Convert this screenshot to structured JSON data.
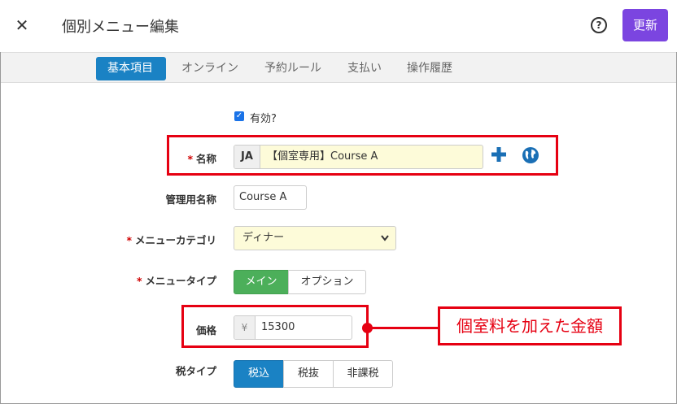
{
  "header": {
    "close_icon": "close-icon",
    "title": "個別メニュー編集",
    "help_icon": "help-icon",
    "update_label": "更新"
  },
  "tabs": [
    {
      "label": "基本項目",
      "active": true
    },
    {
      "label": "オンライン",
      "active": false
    },
    {
      "label": "予約ルール",
      "active": false
    },
    {
      "label": "支払い",
      "active": false
    },
    {
      "label": "操作履歴",
      "active": false
    }
  ],
  "form": {
    "enabled": {
      "label": "有効?",
      "checked": true
    },
    "required_mark": "*",
    "name": {
      "label": "名称",
      "lang": "JA",
      "value": "【個室専用】Course A"
    },
    "admin_name": {
      "label": "管理用名称",
      "value": "Course A"
    },
    "category": {
      "label": "メニューカテゴリ",
      "selected": "ディナー"
    },
    "menu_type": {
      "label": "メニュータイプ",
      "options": [
        "メイン",
        "オプション"
      ],
      "selected": "メイン"
    },
    "price": {
      "label": "価格",
      "currency": "¥",
      "value": "15300"
    },
    "tax_type": {
      "label": "税タイプ",
      "options": [
        "税込",
        "税抜",
        "非課税"
      ],
      "selected": "税込"
    }
  },
  "annotation": {
    "callout_text": "個室料を加えた金額"
  },
  "colors": {
    "accent_purple": "#7b45e0",
    "tab_blue": "#1a82c4",
    "menu_green": "#4caf5a",
    "annotation_red": "#e60012",
    "input_highlight": "#fdfbd9"
  }
}
